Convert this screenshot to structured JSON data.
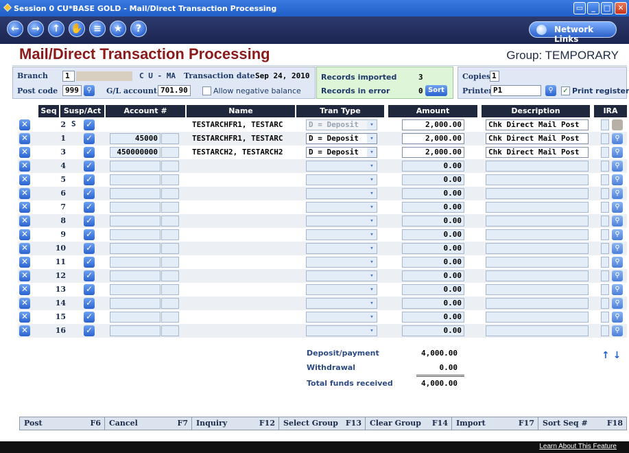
{
  "window": {
    "title": "Session 0 CU*BASE GOLD - Mail/Direct Transaction Processing",
    "controls": [
      "minimize-icon",
      "restore-icon",
      "maximize-icon",
      "close-icon"
    ]
  },
  "nav": {
    "icons": [
      "back-icon",
      "forward-icon",
      "up-icon",
      "hand-icon",
      "print-icon",
      "favorite-icon",
      "help-icon"
    ],
    "network_links": "Network Links"
  },
  "header": {
    "title": "Mail/Direct Transaction Processing",
    "group": "Group: TEMPORARY"
  },
  "form": {
    "branch_label": "Branch",
    "branch_value": "1",
    "cu_text": "C U - MA",
    "txn_date_label": "Transaction date",
    "txn_date_value": "Sep 24, 2010",
    "postcode_label": "Post code",
    "postcode_value": "999",
    "gl_label": "G/L account",
    "gl_value": "701.90",
    "allow_neg_label": "Allow negative balance"
  },
  "import": {
    "records_imported_label": "Records imported",
    "records_imported_value": "3",
    "records_error_label": "Records in error",
    "records_error_value": "0",
    "sort_label": "Sort"
  },
  "print": {
    "copies_label": "Copies",
    "copies_value": "1",
    "printer_label": "Printer",
    "printer_value": "P1",
    "print_register_label": "Print register"
  },
  "table": {
    "columns": [
      "Seq",
      "Susp/Act",
      "Account #",
      "Name",
      "Tran Type",
      "Amount",
      "Description",
      "IRA"
    ],
    "rows": [
      {
        "seq": "2",
        "susp": "S",
        "account": "",
        "name": "TESTARCHFR1, TESTARC",
        "tran": "D = Deposit",
        "amount": "2,000.00",
        "desc": "Chk Direct Mail Post",
        "tran_disabled": true
      },
      {
        "seq": "1",
        "susp": "",
        "account": "45000",
        "name": "TESTARCHFR1, TESTARC",
        "tran": "D = Deposit",
        "amount": "2,000.00",
        "desc": "Chk Direct Mail Post",
        "tran_disabled": false
      },
      {
        "seq": "3",
        "susp": "",
        "account": "450000000",
        "name": "TESTARCH2, TESTARCH2",
        "tran": "D = Deposit",
        "amount": "2,000.00",
        "desc": "Chk Direct Mail Post",
        "tran_disabled": false
      },
      {
        "seq": "4",
        "susp": "",
        "account": "",
        "name": "",
        "tran": "",
        "amount": "0.00",
        "desc": ""
      },
      {
        "seq": "5",
        "susp": "",
        "account": "",
        "name": "",
        "tran": "",
        "amount": "0.00",
        "desc": ""
      },
      {
        "seq": "6",
        "susp": "",
        "account": "",
        "name": "",
        "tran": "",
        "amount": "0.00",
        "desc": ""
      },
      {
        "seq": "7",
        "susp": "",
        "account": "",
        "name": "",
        "tran": "",
        "amount": "0.00",
        "desc": ""
      },
      {
        "seq": "8",
        "susp": "",
        "account": "",
        "name": "",
        "tran": "",
        "amount": "0.00",
        "desc": ""
      },
      {
        "seq": "9",
        "susp": "",
        "account": "",
        "name": "",
        "tran": "",
        "amount": "0.00",
        "desc": ""
      },
      {
        "seq": "10",
        "susp": "",
        "account": "",
        "name": "",
        "tran": "",
        "amount": "0.00",
        "desc": ""
      },
      {
        "seq": "11",
        "susp": "",
        "account": "",
        "name": "",
        "tran": "",
        "amount": "0.00",
        "desc": ""
      },
      {
        "seq": "12",
        "susp": "",
        "account": "",
        "name": "",
        "tran": "",
        "amount": "0.00",
        "desc": ""
      },
      {
        "seq": "13",
        "susp": "",
        "account": "",
        "name": "",
        "tran": "",
        "amount": "0.00",
        "desc": ""
      },
      {
        "seq": "14",
        "susp": "",
        "account": "",
        "name": "",
        "tran": "",
        "amount": "0.00",
        "desc": ""
      },
      {
        "seq": "15",
        "susp": "",
        "account": "",
        "name": "",
        "tran": "",
        "amount": "0.00",
        "desc": ""
      },
      {
        "seq": "16",
        "susp": "",
        "account": "",
        "name": "",
        "tran": "",
        "amount": "0.00",
        "desc": ""
      }
    ]
  },
  "totals": {
    "deposit_label": "Deposit/payment",
    "deposit_value": "4,000.00",
    "withdrawal_label": "Withdrawal",
    "withdrawal_value": "0.00",
    "total_label": "Total funds received",
    "total_value": "4,000.00"
  },
  "fkeys": [
    {
      "label": "Post",
      "key": "F6"
    },
    {
      "label": "Cancel",
      "key": "F7"
    },
    {
      "label": "Inquiry",
      "key": "F12"
    },
    {
      "label": "Select Group",
      "key": "F13"
    },
    {
      "label": "Clear Group",
      "key": "F14"
    },
    {
      "label": "Import",
      "key": "F17"
    },
    {
      "label": "Sort Seq #",
      "key": "F18"
    }
  ],
  "footer": {
    "learn": "Learn About This Feature"
  },
  "colors": {
    "title_red": "#8b1a1a",
    "nav_bg": "#1b2550",
    "accent_blue": "#2b63cf"
  }
}
